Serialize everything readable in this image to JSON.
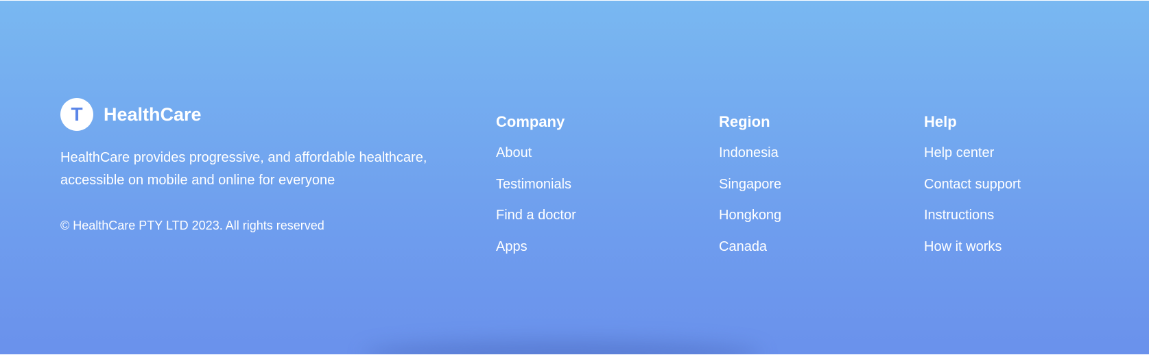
{
  "brand": {
    "logo_letter": "T",
    "name": "HealthCare"
  },
  "description": "HealthCare provides progressive, and affordable healthcare, accessible on mobile and online for everyone",
  "copyright": "© HealthCare PTY LTD 2023. All rights reserved",
  "columns": [
    {
      "title": "Company",
      "links": [
        "About",
        "Testimonials",
        "Find a doctor",
        "Apps"
      ]
    },
    {
      "title": "Region",
      "links": [
        "Indonesia",
        "Singapore",
        "Hongkong",
        "Canada"
      ]
    },
    {
      "title": "Help",
      "links": [
        "Help center",
        "Contact support",
        "Instructions",
        "How it works"
      ]
    }
  ]
}
